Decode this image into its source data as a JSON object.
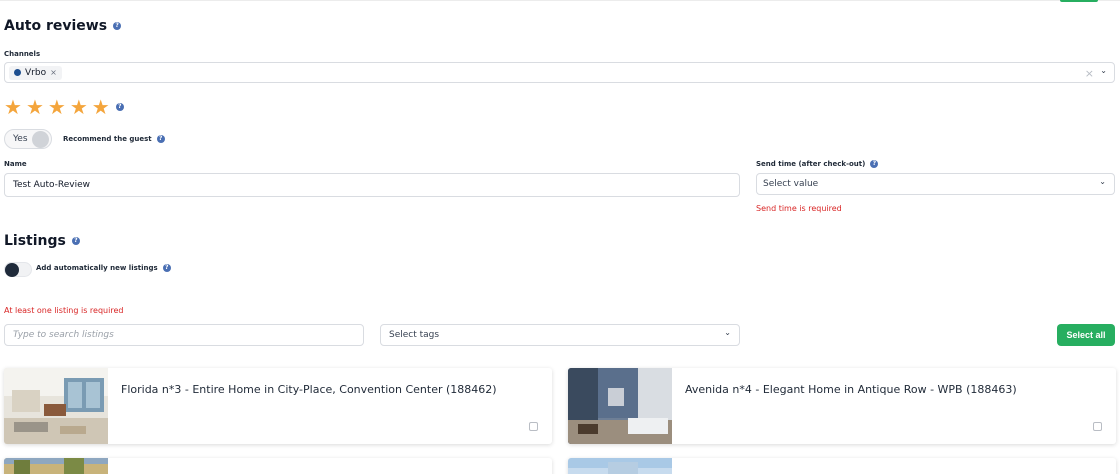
{
  "auto_reviews": {
    "title": "Auto reviews",
    "help_glyph": "?",
    "channels_label": "Channels",
    "channels_selected": [
      "Vrbo"
    ],
    "chip_remove_glyph": "×",
    "clear_glyph": "×",
    "chevron_glyph": "⌄",
    "rating": 5,
    "star_glyph": "★",
    "recommend_toggle_text": "Yes",
    "recommend_label": "Recommend the guest",
    "name_label": "Name",
    "name_value": "Test Auto-Review",
    "send_time_label": "Send time (after check-out)",
    "send_time_placeholder": "Select value",
    "send_time_error": "Send time is required"
  },
  "listings": {
    "title": "Listings",
    "auto_add_label": "Add automatically new listings",
    "auto_add_enabled": false,
    "error": "At least one listing is required",
    "search_placeholder": "Type to search listings",
    "tags_placeholder": "Select tags",
    "select_all_label": "Select all",
    "cards": [
      {
        "title": "Florida n*3 - Entire Home in City-Place, Convention Center  (188462)"
      },
      {
        "title": "Avenida n*4 - Elegant Home in Antique Row - WPB  (188463)"
      }
    ]
  },
  "colors": {
    "accent_green": "#27ae60",
    "star": "#f4a53c",
    "error": "#d92626",
    "help_icon": "#4a6fb3"
  }
}
